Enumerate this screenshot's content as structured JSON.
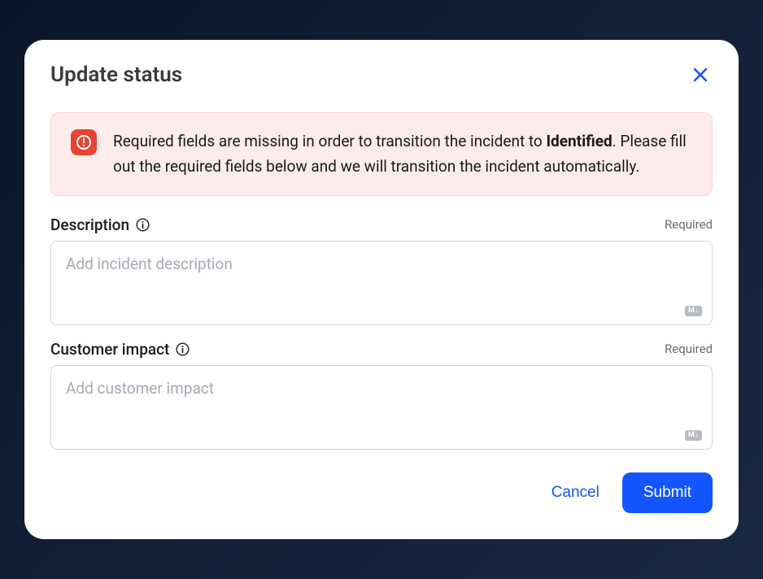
{
  "modal": {
    "title": "Update status",
    "alert": {
      "prefix": "Required fields are missing in order to transition the incident to ",
      "status": "Identified",
      "suffix": ". Please fill out the required fields below and we will transition the incident automatically."
    },
    "fields": {
      "description": {
        "label": "Description",
        "placeholder": "Add incident description",
        "required_tag": "Required",
        "markdown_badge": "M↓"
      },
      "customer_impact": {
        "label": "Customer impact",
        "placeholder": "Add customer impact",
        "required_tag": "Required",
        "markdown_badge": "M↓"
      }
    },
    "footer": {
      "cancel": "Cancel",
      "submit": "Submit"
    }
  }
}
